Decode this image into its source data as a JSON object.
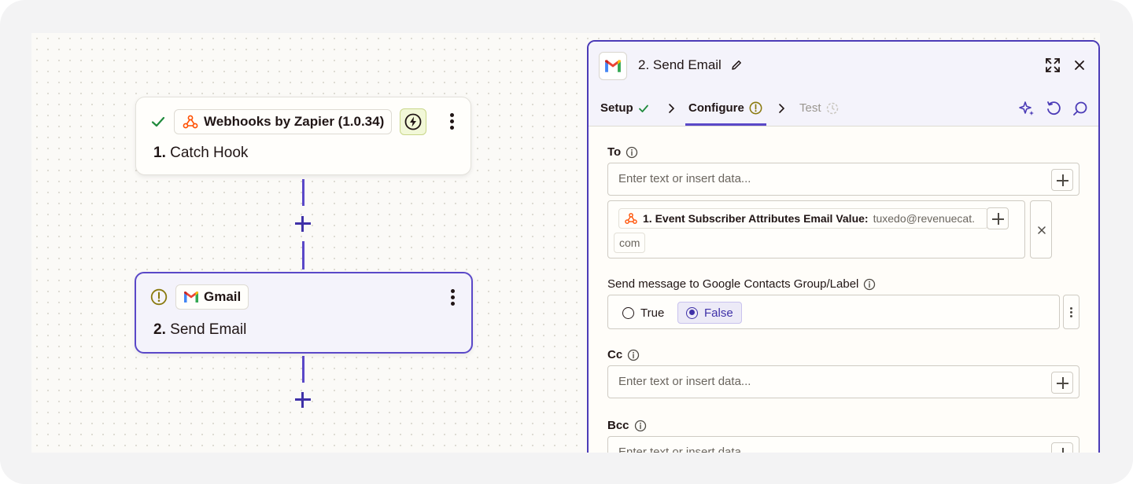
{
  "workflow": {
    "trigger": {
      "app_label": "Webhooks by Zapier (1.0.34)",
      "step_number": "1.",
      "step_title": "Catch Hook"
    },
    "action": {
      "app_label": "Gmail",
      "step_number": "2.",
      "step_title": "Send Email"
    }
  },
  "panel": {
    "title": "2. Send Email",
    "tabs": {
      "setup": "Setup",
      "configure": "Configure",
      "test": "Test"
    },
    "fields": {
      "to_label": "To",
      "to_placeholder": "Enter text or insert data...",
      "to_value_label": "1. Event Subscriber Attributes Email Value:",
      "to_value_text": "tuxedo@revenuecat.",
      "to_value_cont": "com",
      "group_label": "Send message to Google Contacts Group/Label",
      "option_true": "True",
      "option_false": "False",
      "cc_label": "Cc",
      "cc_placeholder": "Enter text or insert data...",
      "bcc_label": "Bcc",
      "bcc_placeholder": "Enter text or insert data..."
    }
  },
  "colors": {
    "accent": "#5a48c8",
    "warning": "#8a7a0f",
    "success": "#1f8a3c",
    "webhook": "#ff4f00"
  },
  "icons": [
    "check-icon",
    "webhook-icon",
    "bolt-icon",
    "warning-icon",
    "gmail-icon",
    "pencil-icon",
    "expand-icon",
    "close-icon",
    "sparkle-icon",
    "undo-icon",
    "search-icon",
    "info-icon",
    "chevron-right-icon"
  ]
}
